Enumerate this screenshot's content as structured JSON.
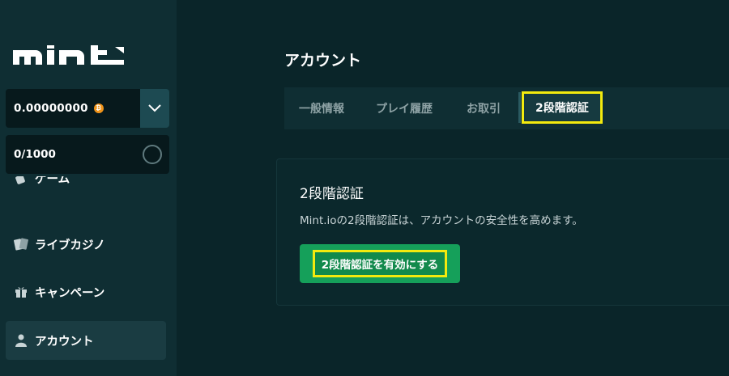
{
  "sidebar": {
    "logo_text": "mint",
    "balance": "0.00000000",
    "coin_symbol": "₿",
    "progress": "0/1000",
    "items": [
      {
        "label": "ゲーム",
        "icon": "dice-icon"
      },
      {
        "label": "ライブカジノ",
        "icon": "cards-icon"
      },
      {
        "label": "キャンペーン",
        "icon": "gift-icon"
      },
      {
        "label": "アカウント",
        "icon": "user-icon"
      }
    ]
  },
  "main": {
    "title": "アカウント",
    "tabs": [
      {
        "label": "一般情報"
      },
      {
        "label": "プレイ履歴"
      },
      {
        "label": "お取引"
      },
      {
        "label": "2段階認証"
      }
    ],
    "card": {
      "title": "2段階認証",
      "description": "Mint.ioの2段階認証は、アカウントの安全性を高めます。",
      "button_label": "2段階認証を有効にする"
    }
  },
  "colors": {
    "background": "#0a2529",
    "sidebar": "#0f2e33",
    "accent_green": "#15a05a",
    "highlight_yellow": "#f3ea0e",
    "coin_orange": "#f0941a"
  }
}
